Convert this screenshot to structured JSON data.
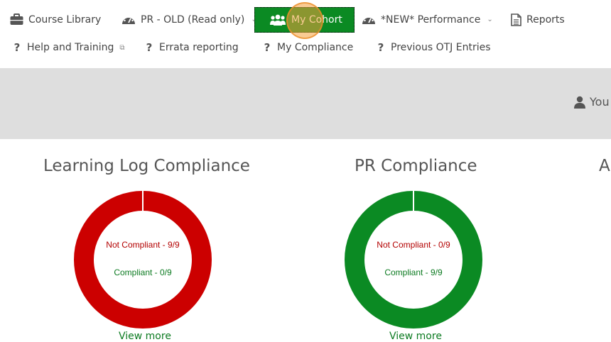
{
  "nav": {
    "row1": [
      {
        "label": "Course Library",
        "icon": "briefcase-icon"
      },
      {
        "label": "PR - OLD (Read only)",
        "icon": "dashboard-icon",
        "dropdown": true
      },
      {
        "label": "My Cohort",
        "icon": "users-icon",
        "active": true
      },
      {
        "label": "*NEW* Performance",
        "icon": "dashboard-icon",
        "dropdown": true
      },
      {
        "label": "Reports",
        "icon": "document-icon"
      }
    ],
    "row2": [
      {
        "label": "Help and Training",
        "icon": "question-icon",
        "external": true
      },
      {
        "label": "Errata reporting",
        "icon": "question-icon"
      },
      {
        "label": "My Compliance",
        "icon": "question-icon"
      },
      {
        "label": "Previous OTJ Entries",
        "icon": "question-icon"
      }
    ]
  },
  "user": {
    "label": "You",
    "icon": "user-icon"
  },
  "cards": [
    {
      "title": "Learning Log Compliance",
      "not_compliant_label": "Not Compliant - 9/9",
      "compliant_label": "Compliant - 0/9",
      "compliant": 0,
      "total": 9,
      "view_more": "View more"
    },
    {
      "title": "PR Compliance",
      "not_compliant_label": "Not Compliant - 0/9",
      "compliant_label": "Compliant - 9/9",
      "compliant": 9,
      "total": 9,
      "view_more": "View more"
    },
    {
      "title": "A"
    }
  ],
  "colors": {
    "active_green": "#0b8a23",
    "red": "#cc0000",
    "green": "#0b8a23",
    "band": "#dedede"
  }
}
